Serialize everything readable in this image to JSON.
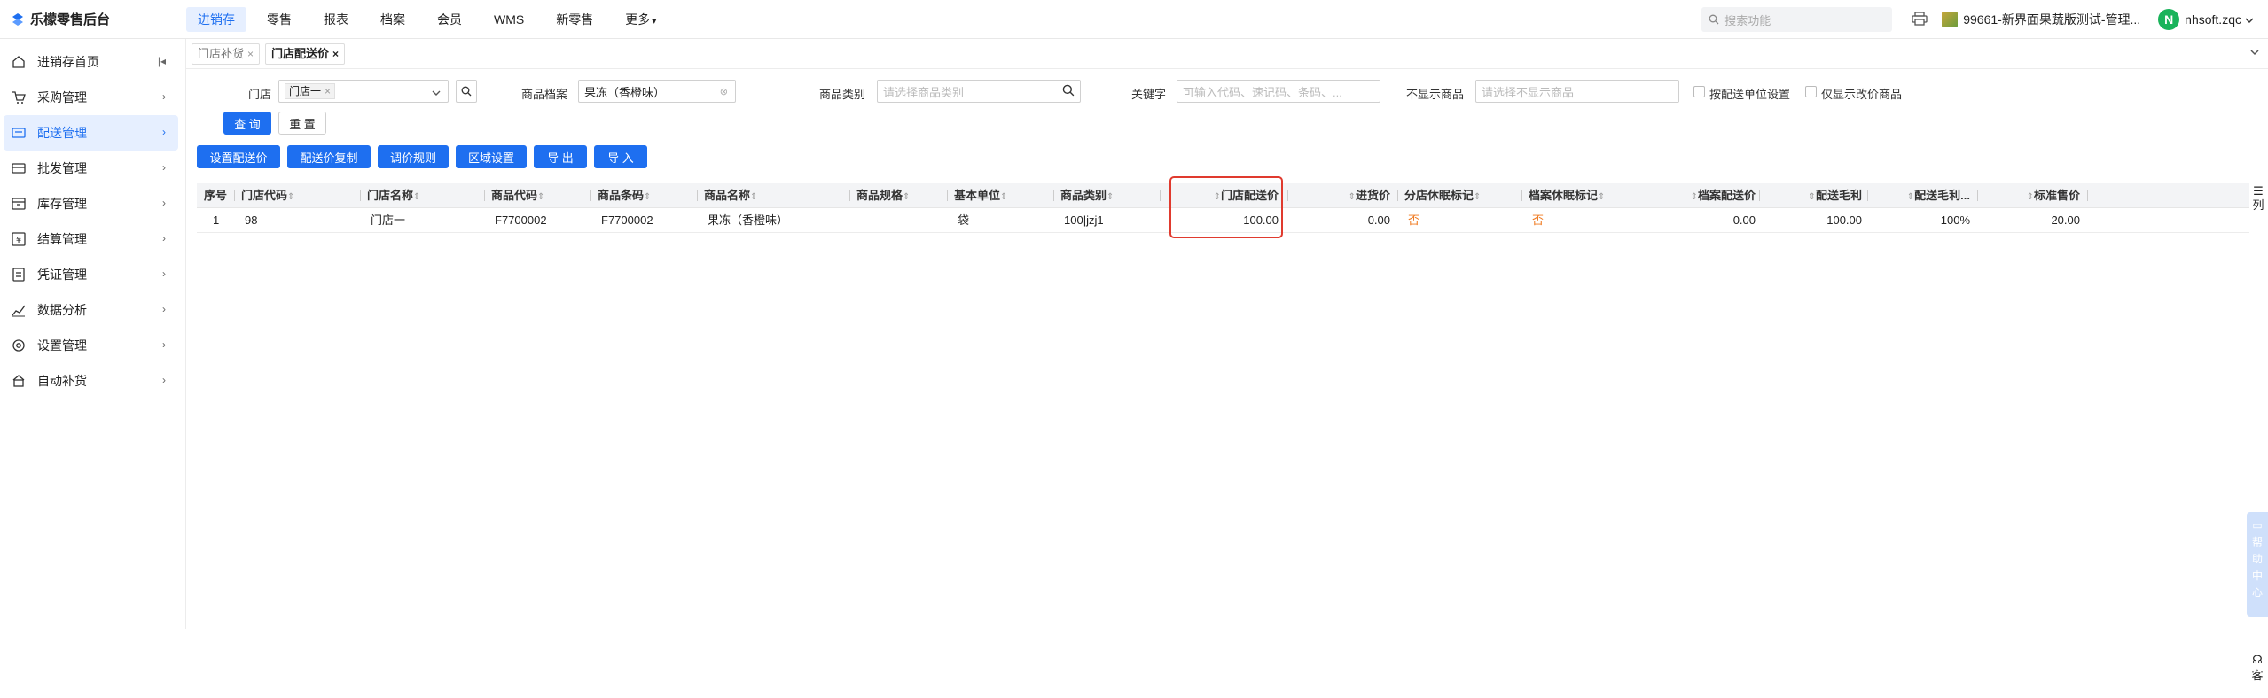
{
  "app": {
    "title": "乐檬零售后台"
  },
  "topnav": {
    "items": [
      {
        "label": "进销存",
        "active": true
      },
      {
        "label": "零售"
      },
      {
        "label": "报表"
      },
      {
        "label": "档案"
      },
      {
        "label": "会员"
      },
      {
        "label": "WMS"
      },
      {
        "label": "新零售"
      },
      {
        "label": "更多"
      }
    ]
  },
  "header": {
    "search_placeholder": "搜索功能",
    "store": "99661-新界面果蔬版测试-管理...",
    "user_initial": "N",
    "user_name": "nhsoft.zqc"
  },
  "sidebar": {
    "items": [
      {
        "label": "进销存首页",
        "icon": "home-icon"
      },
      {
        "label": "采购管理",
        "icon": "cart-icon"
      },
      {
        "label": "配送管理",
        "icon": "truck-icon",
        "active": true
      },
      {
        "label": "批发管理",
        "icon": "wholesale-icon"
      },
      {
        "label": "库存管理",
        "icon": "inventory-icon"
      },
      {
        "label": "结算管理",
        "icon": "settlement-icon"
      },
      {
        "label": "凭证管理",
        "icon": "voucher-icon"
      },
      {
        "label": "数据分析",
        "icon": "chart-icon"
      },
      {
        "label": "设置管理",
        "icon": "settings-icon"
      },
      {
        "label": "自动补货",
        "icon": "replenish-icon"
      }
    ]
  },
  "tabs": [
    {
      "label": "门店补货",
      "active": false
    },
    {
      "label": "门店配送价",
      "active": true
    }
  ],
  "filters": {
    "store_label": "门店",
    "store_chip": "门店一",
    "product_label": "商品档案",
    "product_value": "果冻（香橙味）",
    "category_label": "商品类别",
    "category_placeholder": "请选择商品类别",
    "keyword_label": "关键字",
    "keyword_placeholder": "可输入代码、速记码、条码、...",
    "hidden_label": "不显示商品",
    "hidden_placeholder": "请选择不显示商品",
    "check_unit": "按配送单位设置",
    "check_changed": "仅显示改价商品",
    "query_btn": "查 询",
    "reset_btn": "重 置"
  },
  "toolbar": {
    "set_price": "设置配送价",
    "copy_price": "配送价复制",
    "adjust_rule": "调价规则",
    "region": "区域设置",
    "export": "导 出",
    "import": "导 入"
  },
  "table": {
    "headers": [
      "序号",
      "门店代码",
      "门店名称",
      "商品代码",
      "商品条码",
      "商品名称",
      "商品规格",
      "基本单位",
      "商品类别",
      "门店配送价",
      "进货价",
      "分店休眠标记",
      "档案休眠标记",
      "档案配送价",
      "配送毛利",
      "配送毛利...",
      "标准售价"
    ],
    "rows": [
      [
        "1",
        "98",
        "门店一",
        "F7700002",
        "F7700002",
        "果冻（香橙味）",
        "",
        "袋",
        "100|jzj1",
        "100.00",
        "0.00",
        "否",
        "否",
        "0.00",
        "100.00",
        "100%",
        "20.00"
      ]
    ]
  },
  "side_widgets": {
    "columns": "列",
    "help": [
      "帮",
      "助",
      "中",
      "心"
    ],
    "service": "客"
  },
  "colors": {
    "accent": "#1e6ff0",
    "highlight": "#e03a2e",
    "warn": "#f07a20"
  }
}
